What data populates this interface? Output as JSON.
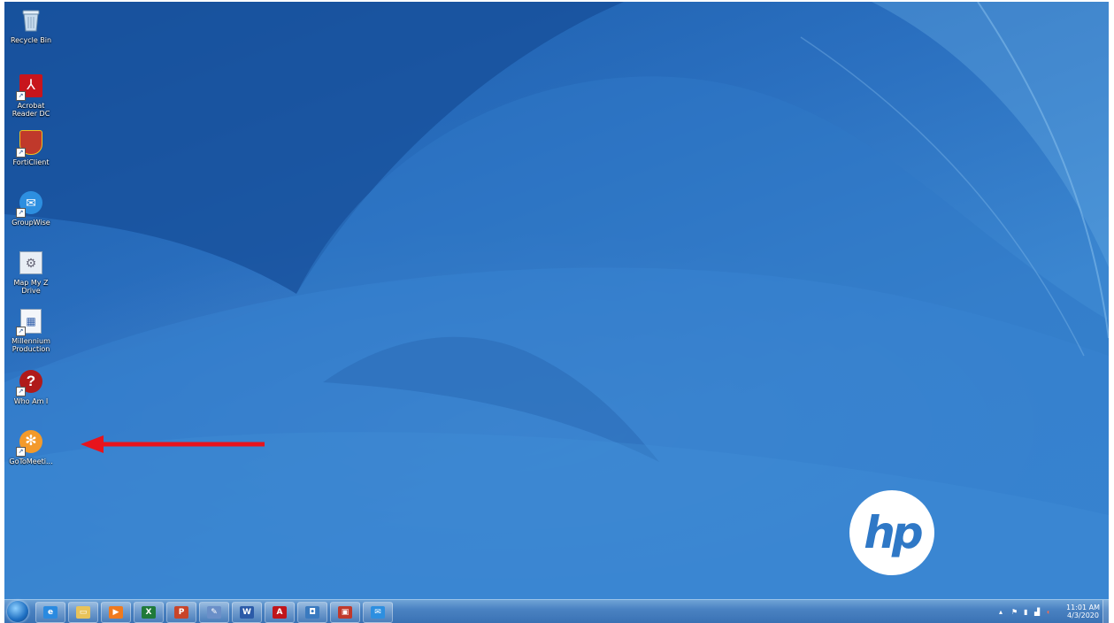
{
  "desktop": {
    "icons": [
      {
        "label": "Recycle Bin",
        "icon": "recycle-bin-icon"
      },
      {
        "label": "Acrobat Reader DC",
        "icon": "acrobat-icon"
      },
      {
        "label": "FortiClient",
        "icon": "forticlient-icon"
      },
      {
        "label": "GroupWise",
        "icon": "groupwise-icon"
      },
      {
        "label": "Map My Z Drive",
        "icon": "map-drive-icon"
      },
      {
        "label": "Millennium Production",
        "icon": "millennium-icon"
      },
      {
        "label": "Who Am I",
        "icon": "question-icon"
      },
      {
        "label": "GoToMeeti...",
        "icon": "gotomeeting-icon"
      }
    ],
    "annotation_arrow_color": "#e8141c",
    "logo_text": "hp"
  },
  "taskbar": {
    "pinned": [
      {
        "name": "internet-explorer",
        "glyph": "e",
        "color": "#2a8ae0"
      },
      {
        "name": "file-explorer",
        "glyph": "▭",
        "color": "#e8c35a"
      },
      {
        "name": "media-player",
        "glyph": "▶",
        "color": "#f07a1e"
      },
      {
        "name": "excel",
        "glyph": "X",
        "color": "#1f7a3a"
      },
      {
        "name": "powerpoint",
        "glyph": "P",
        "color": "#c8452a"
      },
      {
        "name": "paint",
        "glyph": "✎",
        "color": "#6a8fc8"
      },
      {
        "name": "word",
        "glyph": "W",
        "color": "#2b5aa8"
      },
      {
        "name": "acrobat",
        "glyph": "A",
        "color": "#c0151b"
      },
      {
        "name": "scanner",
        "glyph": "◘",
        "color": "#3a7abf"
      },
      {
        "name": "forticlient",
        "glyph": "▣",
        "color": "#c0392b"
      },
      {
        "name": "groupwise",
        "glyph": "✉",
        "color": "#2d8fe0"
      }
    ],
    "clock": {
      "time": "11:01 AM",
      "date": "4/3/2020"
    }
  }
}
